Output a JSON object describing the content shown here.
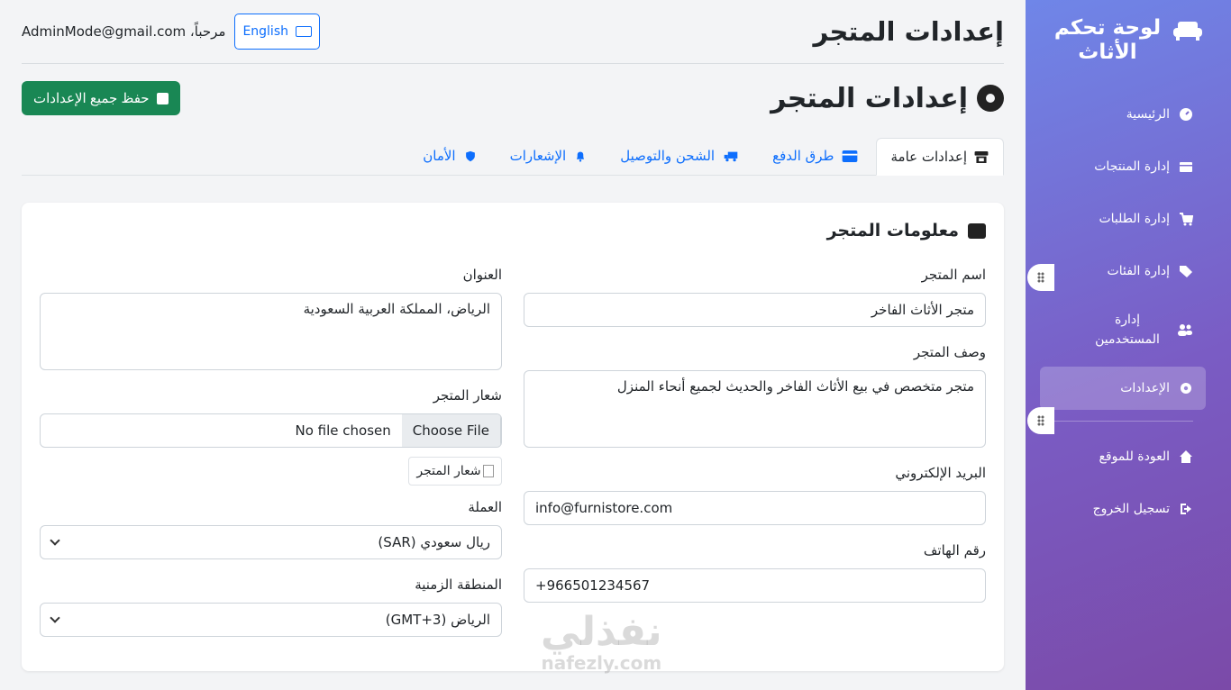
{
  "sidebar": {
    "title": "لوحة تحكم الأثاث",
    "items": [
      {
        "label": "الرئيسية",
        "icon": "dashboard-icon"
      },
      {
        "label": "إدارة المنتجات",
        "icon": "box-icon"
      },
      {
        "label": "إدارة الطلبات",
        "icon": "cart-icon"
      },
      {
        "label": "إدارة الفئات",
        "icon": "tags-icon"
      },
      {
        "label": "إدارة المستخدمين",
        "icon": "users-icon"
      },
      {
        "label": "الإعدادات",
        "icon": "gear-icon",
        "active": true
      }
    ],
    "bottom": [
      {
        "label": "العودة للموقع",
        "icon": "home-icon"
      },
      {
        "label": "تسجيل الخروج",
        "icon": "logout-icon"
      }
    ]
  },
  "header": {
    "page_title": "إعدادات المتجر",
    "greeting": "مرحباً، AdminMode@gmail.com",
    "lang_button": "English"
  },
  "section": {
    "title": "إعدادات المتجر",
    "save_label": "حفظ جميع الإعدادات"
  },
  "tabs": [
    {
      "label": "إعدادات عامة",
      "active": true
    },
    {
      "label": "طرق الدفع"
    },
    {
      "label": "الشحن والتوصيل"
    },
    {
      "label": "الإشعارات"
    },
    {
      "label": "الأمان"
    }
  ],
  "card": {
    "title": "معلومات المتجر",
    "store_name_label": "اسم المتجر",
    "store_name_value": "متجر الأثاث الفاخر",
    "desc_label": "وصف المتجر",
    "desc_value": "متجر متخصص في بيع الأثاث الفاخر والحديث لجميع أنحاء المنزل",
    "email_label": "البريد الإلكتروني",
    "email_value": "info@furnistore.com",
    "phone_label": "رقم الهاتف",
    "phone_value": "+966501234567",
    "address_label": "العنوان",
    "address_value": "الرياض، المملكة العربية السعودية",
    "logo_label": "شعار المتجر",
    "file_button": "Choose File",
    "file_status": "No file chosen",
    "logo_alt": "شعار المتجر",
    "currency_label": "العملة",
    "currency_value": "ريال سعودي (SAR)",
    "timezone_label": "المنطقة الزمنية",
    "timezone_value": "الرياض (GMT+3)"
  },
  "watermark": {
    "arabic": "نفذلي",
    "latin": "nafezly.com"
  },
  "colors": {
    "primary": "#0d6efd",
    "success": "#198754",
    "sidebar_start": "#6f86e8",
    "sidebar_end": "#7b4aa8"
  }
}
